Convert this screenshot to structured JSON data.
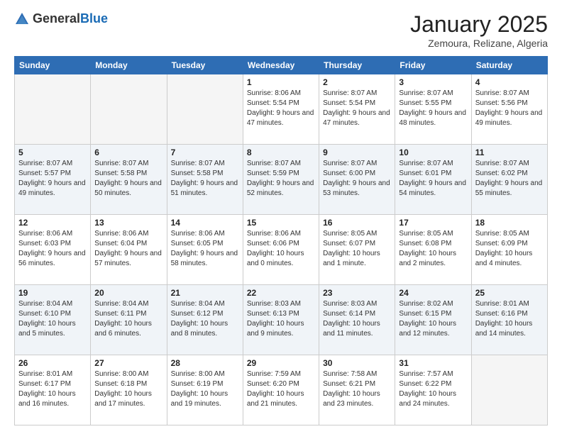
{
  "header": {
    "logo_line1": "General",
    "logo_line2": "Blue",
    "month": "January 2025",
    "location": "Zemoura, Relizane, Algeria"
  },
  "weekdays": [
    "Sunday",
    "Monday",
    "Tuesday",
    "Wednesday",
    "Thursday",
    "Friday",
    "Saturday"
  ],
  "weeks": [
    [
      {
        "day": "",
        "info": ""
      },
      {
        "day": "",
        "info": ""
      },
      {
        "day": "",
        "info": ""
      },
      {
        "day": "1",
        "info": "Sunrise: 8:06 AM\nSunset: 5:54 PM\nDaylight: 9 hours and 47 minutes."
      },
      {
        "day": "2",
        "info": "Sunrise: 8:07 AM\nSunset: 5:54 PM\nDaylight: 9 hours and 47 minutes."
      },
      {
        "day": "3",
        "info": "Sunrise: 8:07 AM\nSunset: 5:55 PM\nDaylight: 9 hours and 48 minutes."
      },
      {
        "day": "4",
        "info": "Sunrise: 8:07 AM\nSunset: 5:56 PM\nDaylight: 9 hours and 49 minutes."
      }
    ],
    [
      {
        "day": "5",
        "info": "Sunrise: 8:07 AM\nSunset: 5:57 PM\nDaylight: 9 hours and 49 minutes."
      },
      {
        "day": "6",
        "info": "Sunrise: 8:07 AM\nSunset: 5:58 PM\nDaylight: 9 hours and 50 minutes."
      },
      {
        "day": "7",
        "info": "Sunrise: 8:07 AM\nSunset: 5:58 PM\nDaylight: 9 hours and 51 minutes."
      },
      {
        "day": "8",
        "info": "Sunrise: 8:07 AM\nSunset: 5:59 PM\nDaylight: 9 hours and 52 minutes."
      },
      {
        "day": "9",
        "info": "Sunrise: 8:07 AM\nSunset: 6:00 PM\nDaylight: 9 hours and 53 minutes."
      },
      {
        "day": "10",
        "info": "Sunrise: 8:07 AM\nSunset: 6:01 PM\nDaylight: 9 hours and 54 minutes."
      },
      {
        "day": "11",
        "info": "Sunrise: 8:07 AM\nSunset: 6:02 PM\nDaylight: 9 hours and 55 minutes."
      }
    ],
    [
      {
        "day": "12",
        "info": "Sunrise: 8:06 AM\nSunset: 6:03 PM\nDaylight: 9 hours and 56 minutes."
      },
      {
        "day": "13",
        "info": "Sunrise: 8:06 AM\nSunset: 6:04 PM\nDaylight: 9 hours and 57 minutes."
      },
      {
        "day": "14",
        "info": "Sunrise: 8:06 AM\nSunset: 6:05 PM\nDaylight: 9 hours and 58 minutes."
      },
      {
        "day": "15",
        "info": "Sunrise: 8:06 AM\nSunset: 6:06 PM\nDaylight: 10 hours and 0 minutes."
      },
      {
        "day": "16",
        "info": "Sunrise: 8:05 AM\nSunset: 6:07 PM\nDaylight: 10 hours and 1 minute."
      },
      {
        "day": "17",
        "info": "Sunrise: 8:05 AM\nSunset: 6:08 PM\nDaylight: 10 hours and 2 minutes."
      },
      {
        "day": "18",
        "info": "Sunrise: 8:05 AM\nSunset: 6:09 PM\nDaylight: 10 hours and 4 minutes."
      }
    ],
    [
      {
        "day": "19",
        "info": "Sunrise: 8:04 AM\nSunset: 6:10 PM\nDaylight: 10 hours and 5 minutes."
      },
      {
        "day": "20",
        "info": "Sunrise: 8:04 AM\nSunset: 6:11 PM\nDaylight: 10 hours and 6 minutes."
      },
      {
        "day": "21",
        "info": "Sunrise: 8:04 AM\nSunset: 6:12 PM\nDaylight: 10 hours and 8 minutes."
      },
      {
        "day": "22",
        "info": "Sunrise: 8:03 AM\nSunset: 6:13 PM\nDaylight: 10 hours and 9 minutes."
      },
      {
        "day": "23",
        "info": "Sunrise: 8:03 AM\nSunset: 6:14 PM\nDaylight: 10 hours and 11 minutes."
      },
      {
        "day": "24",
        "info": "Sunrise: 8:02 AM\nSunset: 6:15 PM\nDaylight: 10 hours and 12 minutes."
      },
      {
        "day": "25",
        "info": "Sunrise: 8:01 AM\nSunset: 6:16 PM\nDaylight: 10 hours and 14 minutes."
      }
    ],
    [
      {
        "day": "26",
        "info": "Sunrise: 8:01 AM\nSunset: 6:17 PM\nDaylight: 10 hours and 16 minutes."
      },
      {
        "day": "27",
        "info": "Sunrise: 8:00 AM\nSunset: 6:18 PM\nDaylight: 10 hours and 17 minutes."
      },
      {
        "day": "28",
        "info": "Sunrise: 8:00 AM\nSunset: 6:19 PM\nDaylight: 10 hours and 19 minutes."
      },
      {
        "day": "29",
        "info": "Sunrise: 7:59 AM\nSunset: 6:20 PM\nDaylight: 10 hours and 21 minutes."
      },
      {
        "day": "30",
        "info": "Sunrise: 7:58 AM\nSunset: 6:21 PM\nDaylight: 10 hours and 23 minutes."
      },
      {
        "day": "31",
        "info": "Sunrise: 7:57 AM\nSunset: 6:22 PM\nDaylight: 10 hours and 24 minutes."
      },
      {
        "day": "",
        "info": ""
      }
    ]
  ]
}
